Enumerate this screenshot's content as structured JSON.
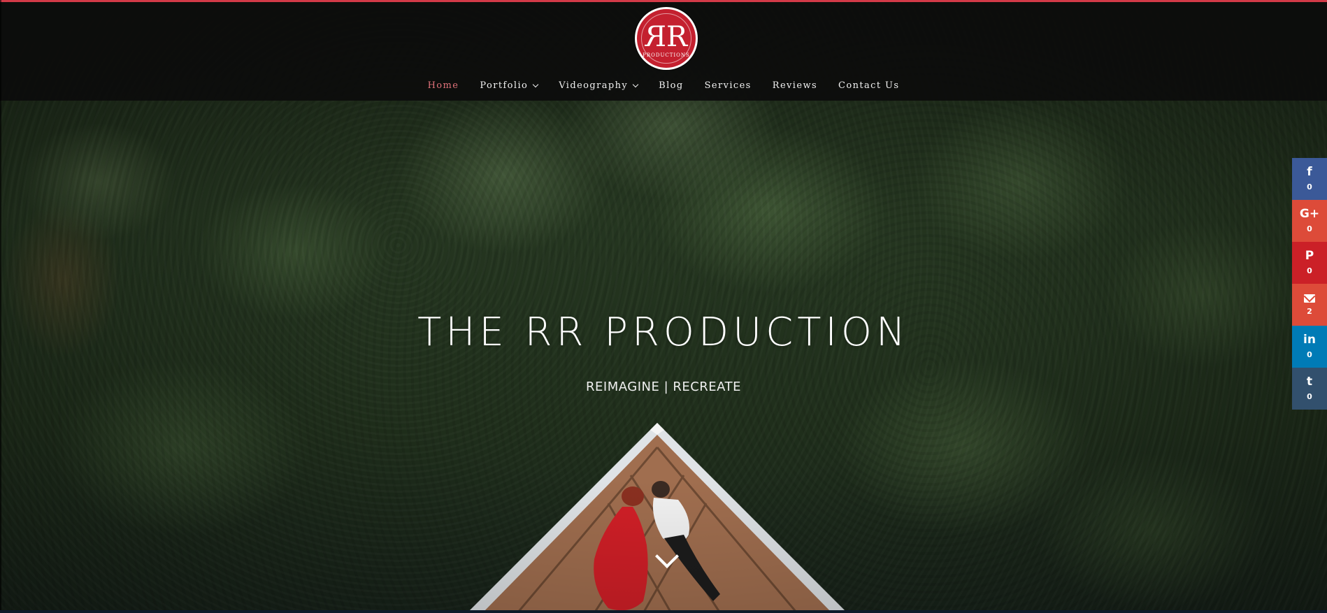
{
  "header": {
    "logo": {
      "mark": "RR",
      "subtitle": "PRODUCTIONS"
    },
    "accent_color": "#d23a48",
    "nav": [
      {
        "label": "Home",
        "active": true,
        "has_dropdown": false
      },
      {
        "label": "Portfolio",
        "active": false,
        "has_dropdown": true
      },
      {
        "label": "Videography",
        "active": false,
        "has_dropdown": true
      },
      {
        "label": "Blog",
        "active": false,
        "has_dropdown": false
      },
      {
        "label": "Services",
        "active": false,
        "has_dropdown": false
      },
      {
        "label": "Reviews",
        "active": false,
        "has_dropdown": false
      },
      {
        "label": "Contact Us",
        "active": false,
        "has_dropdown": false
      }
    ]
  },
  "hero": {
    "title": "THE RR PRODUCTION",
    "subtitle": "REIMAGINE | RECREATE",
    "scroll_icon": "chevron-down-icon"
  },
  "share": [
    {
      "network": "facebook",
      "glyph": "f",
      "count": "0",
      "color": "#3b5998",
      "icon": "facebook-icon"
    },
    {
      "network": "google-plus",
      "glyph": "G+",
      "count": "0",
      "color": "#dd4b39",
      "icon": "google-plus-icon"
    },
    {
      "network": "pinterest",
      "glyph": "P",
      "count": "0",
      "color": "#cb2027",
      "icon": "pinterest-icon"
    },
    {
      "network": "email",
      "glyph": "",
      "count": "2",
      "color": "#dd4b39",
      "icon": "mail-icon"
    },
    {
      "network": "linkedin",
      "glyph": "in",
      "count": "0",
      "color": "#007bb6",
      "icon": "linkedin-icon"
    },
    {
      "network": "tumblr",
      "glyph": "t",
      "count": "0",
      "color": "#32506d",
      "icon": "tumblr-icon"
    }
  ]
}
